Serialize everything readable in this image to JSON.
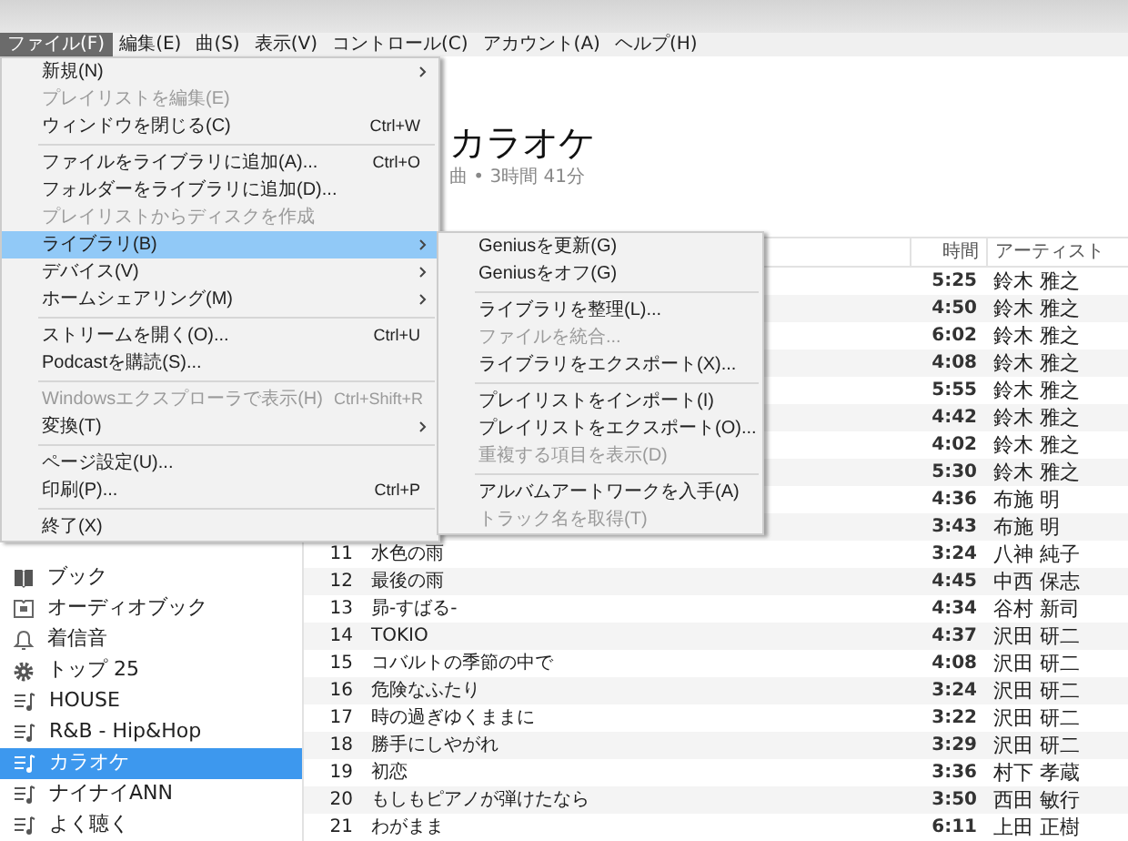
{
  "menubar": [
    {
      "label": "ファイル(F)",
      "selected": true
    },
    {
      "label": "編集(E)",
      "selected": false
    },
    {
      "label": "曲(S)",
      "selected": false
    },
    {
      "label": "表示(V)",
      "selected": false
    },
    {
      "label": "コントロール(C)",
      "selected": false
    },
    {
      "label": "アカウント(A)",
      "selected": false
    },
    {
      "label": "ヘルプ(H)",
      "selected": false
    }
  ],
  "sidebar": {
    "items": [
      {
        "label": "ブック",
        "kind": "book",
        "selected": false
      },
      {
        "label": "オーディオブック",
        "kind": "audiobook",
        "selected": false
      },
      {
        "label": "着信音",
        "kind": "ringtone",
        "selected": false
      },
      {
        "label": "トップ 25",
        "kind": "smart",
        "selected": false
      },
      {
        "label": "HOUSE",
        "kind": "playlist",
        "selected": false
      },
      {
        "label": "R&B - Hip&Hop",
        "kind": "playlist",
        "selected": false
      },
      {
        "label": "カラオケ",
        "kind": "playlist",
        "selected": true
      },
      {
        "label": "ナイナイANN",
        "kind": "playlist",
        "selected": false
      },
      {
        "label": "よく聴く",
        "kind": "playlist",
        "selected": false
      }
    ]
  },
  "playlist": {
    "title": "カラオケ",
    "summary": "曲 • 3時間 41分"
  },
  "table": {
    "columns": [
      "時間",
      "アーティスト"
    ],
    "rows": [
      {
        "time": "5:25",
        "artist": "鈴木 雅之"
      },
      {
        "time": "4:50",
        "artist": "鈴木 雅之"
      },
      {
        "time": "6:02",
        "artist": "鈴木 雅之"
      },
      {
        "time": "4:08",
        "artist": "鈴木 雅之"
      },
      {
        "time": "5:55",
        "artist": "鈴木 雅之"
      },
      {
        "time": "4:42",
        "artist": "鈴木 雅之"
      },
      {
        "time": "4:02",
        "artist": "鈴木 雅之"
      },
      {
        "time": "5:30",
        "artist": "鈴木 雅之"
      },
      {
        "time": "4:36",
        "artist": "布施 明"
      },
      {
        "time": "3:43",
        "artist": "布施 明"
      },
      {
        "number": "11",
        "title": "水色の雨",
        "time": "3:24",
        "artist": "八神 純子"
      },
      {
        "number": "12",
        "title": "最後の雨",
        "time": "4:45",
        "artist": "中西 保志"
      },
      {
        "number": "13",
        "title": "昴-すばる-",
        "time": "4:34",
        "artist": "谷村 新司"
      },
      {
        "number": "14",
        "title": "TOKIO",
        "time": "4:37",
        "artist": "沢田 研二"
      },
      {
        "number": "15",
        "title": "コバルトの季節の中で",
        "time": "4:08",
        "artist": "沢田 研二"
      },
      {
        "number": "16",
        "title": "危険なふたり",
        "time": "3:24",
        "artist": "沢田 研二"
      },
      {
        "number": "17",
        "title": "時の過ぎゆくままに",
        "time": "3:22",
        "artist": "沢田 研二"
      },
      {
        "number": "18",
        "title": "勝手にしやがれ",
        "time": "3:29",
        "artist": "沢田 研二"
      },
      {
        "number": "19",
        "title": "初恋",
        "time": "3:36",
        "artist": "村下 孝蔵"
      },
      {
        "number": "20",
        "title": "もしもピアノが弾けたなら",
        "time": "3:50",
        "artist": "西田 敏行"
      },
      {
        "number": "21",
        "title": "わがまま",
        "time": "6:11",
        "artist": "上田 正樹"
      }
    ]
  },
  "file_menu": [
    {
      "kind": "item",
      "label": "新規(N)",
      "submenu": true,
      "disabled": false,
      "selected": false
    },
    {
      "kind": "item",
      "label": "プレイリストを編集(E)",
      "disabled": true,
      "selected": false
    },
    {
      "kind": "item",
      "label": "ウィンドウを閉じる(C)",
      "shortcut": "Ctrl+W",
      "disabled": false,
      "selected": false
    },
    {
      "kind": "separator"
    },
    {
      "kind": "item",
      "label": "ファイルをライブラリに追加(A)...",
      "shortcut": "Ctrl+O",
      "disabled": false,
      "selected": false
    },
    {
      "kind": "item",
      "label": "フォルダーをライブラリに追加(D)...",
      "disabled": false,
      "selected": false
    },
    {
      "kind": "item",
      "label": "プレイリストからディスクを作成",
      "disabled": true,
      "selected": false
    },
    {
      "kind": "item",
      "label": "ライブラリ(B)",
      "submenu": true,
      "disabled": false,
      "selected": true
    },
    {
      "kind": "item",
      "label": "デバイス(V)",
      "submenu": true,
      "disabled": false,
      "selected": false
    },
    {
      "kind": "item",
      "label": "ホームシェアリング(M)",
      "submenu": true,
      "disabled": false,
      "selected": false
    },
    {
      "kind": "separator"
    },
    {
      "kind": "item",
      "label": "ストリームを開く(O)...",
      "shortcut": "Ctrl+U",
      "disabled": false,
      "selected": false
    },
    {
      "kind": "item",
      "label": "Podcastを購読(S)...",
      "disabled": false,
      "selected": false
    },
    {
      "kind": "separator"
    },
    {
      "kind": "item",
      "label": "Windowsエクスプローラで表示(H)",
      "shortcut": "Ctrl+Shift+R",
      "disabled": true,
      "selected": false
    },
    {
      "kind": "item",
      "label": "変換(T)",
      "submenu": true,
      "disabled": false,
      "selected": false
    },
    {
      "kind": "separator"
    },
    {
      "kind": "item",
      "label": "ページ設定(U)...",
      "disabled": false,
      "selected": false
    },
    {
      "kind": "item",
      "label": "印刷(P)...",
      "shortcut": "Ctrl+P",
      "disabled": false,
      "selected": false
    },
    {
      "kind": "separator"
    },
    {
      "kind": "item",
      "label": "終了(X)",
      "disabled": false,
      "selected": false
    }
  ],
  "library_submenu": [
    {
      "kind": "item",
      "label": "Geniusを更新(G)",
      "disabled": false
    },
    {
      "kind": "item",
      "label": "Geniusをオフ(G)",
      "disabled": false
    },
    {
      "kind": "separator"
    },
    {
      "kind": "item",
      "label": "ライブラリを整理(L)...",
      "disabled": false
    },
    {
      "kind": "item",
      "label": "ファイルを統合...",
      "disabled": true
    },
    {
      "kind": "item",
      "label": "ライブラリをエクスポート(X)...",
      "disabled": false
    },
    {
      "kind": "separator"
    },
    {
      "kind": "item",
      "label": "プレイリストをインポート(I)",
      "disabled": false
    },
    {
      "kind": "item",
      "label": "プレイリストをエクスポート(O)...",
      "disabled": false
    },
    {
      "kind": "item",
      "label": "重複する項目を表示(D)",
      "disabled": true
    },
    {
      "kind": "separator"
    },
    {
      "kind": "item",
      "label": "アルバムアートワークを入手(A)",
      "disabled": false
    },
    {
      "kind": "item",
      "label": "トラック名を取得(T)",
      "disabled": true
    }
  ]
}
